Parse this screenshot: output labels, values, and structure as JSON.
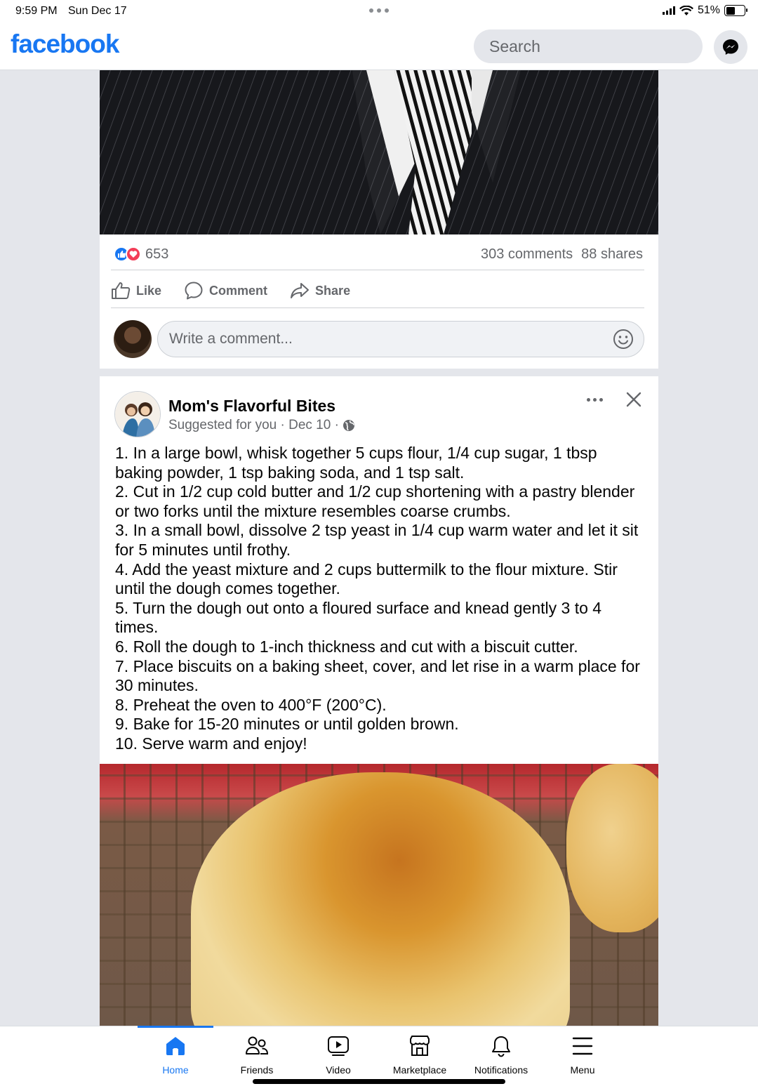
{
  "status": {
    "time": "9:59 PM",
    "date": "Sun Dec 17",
    "battery": "51%",
    "battery_level": 0.51
  },
  "header": {
    "logo": "facebook",
    "search_placeholder": "Search"
  },
  "post1": {
    "reaction_count": "653",
    "comments": "303 comments",
    "shares": "88 shares",
    "actions": {
      "like": "Like",
      "comment": "Comment",
      "share": "Share"
    },
    "comment_placeholder": "Write a comment..."
  },
  "post2": {
    "page_name": "Mom's Flavorful Bites",
    "meta": "Suggested for you · Dec 10 ·",
    "lines": [
      "1. In a large bowl, whisk together 5 cups flour, 1/4 cup sugar, 1 tbsp baking powder, 1 tsp baking soda, and 1 tsp salt.",
      "2. Cut in 1/2 cup cold butter and 1/2 cup shortening with a pastry blender or two forks until the mixture resembles coarse crumbs.",
      "3. In a small bowl, dissolve 2 tsp yeast in 1/4 cup warm water and let it sit for 5 minutes until frothy.",
      "4. Add the yeast mixture and 2 cups buttermilk to the flour mixture. Stir until the dough comes together.",
      "5. Turn the dough out onto a floured surface and knead gently 3 to 4 times.",
      "6. Roll the dough to 1-inch thickness and cut with a biscuit cutter.",
      "7. Place biscuits on a baking sheet, cover, and let rise in a warm place for 30 minutes.",
      "8. Preheat the oven to 400°F (200°C).",
      "9. Bake for 15-20 minutes or until golden brown.",
      "10. Serve warm and enjoy!"
    ]
  },
  "nav": {
    "items": [
      {
        "label": "Home",
        "icon": "home-icon"
      },
      {
        "label": "Friends",
        "icon": "friends-icon"
      },
      {
        "label": "Video",
        "icon": "video-icon"
      },
      {
        "label": "Marketplace",
        "icon": "marketplace-icon"
      },
      {
        "label": "Notifications",
        "icon": "bell-icon"
      },
      {
        "label": "Menu",
        "icon": "menu-icon"
      }
    ]
  },
  "colors": {
    "brand": "#1877f2",
    "background": "#e4e6eb",
    "secondary_text": "#65676b"
  }
}
